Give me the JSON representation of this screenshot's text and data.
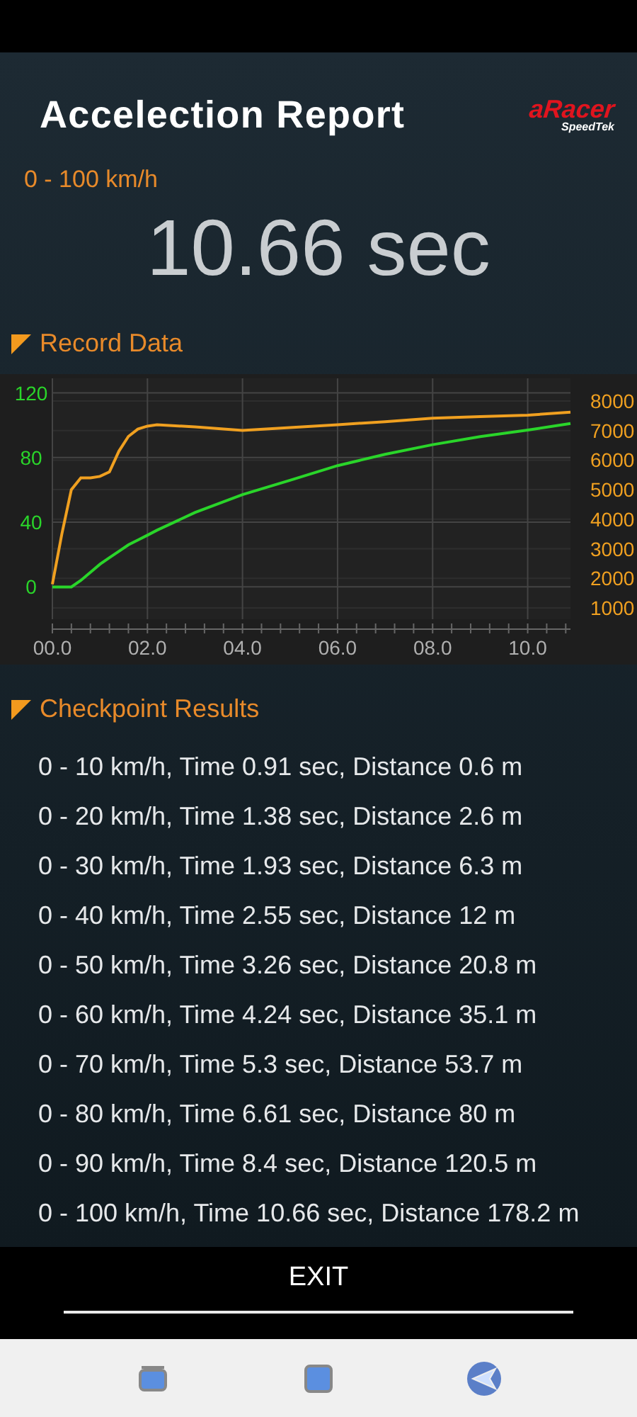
{
  "header": {
    "title": "Accelection Report",
    "logo": {
      "brand": "aRacer",
      "sub": "SpeedTek"
    }
  },
  "range": "0 - 100 km/h",
  "result": "10.66 sec",
  "record_section": {
    "title": "Record Data",
    "chart_data": {
      "type": "line",
      "grid": true,
      "xlim": [
        0,
        10.9
      ],
      "ylim": [
        -20,
        129
      ],
      "y2lim": [
        616,
        8766
      ],
      "xticks": [
        {
          "value": 0,
          "label": "00.0"
        },
        {
          "value": 2,
          "label": "02.0"
        },
        {
          "value": 4,
          "label": "04.0"
        },
        {
          "value": 6,
          "label": "06.0"
        },
        {
          "value": 8,
          "label": "08.0"
        },
        {
          "value": 10,
          "label": "10.0"
        }
      ],
      "yticks": [
        0,
        40,
        80,
        120
      ],
      "y2ticks": [
        1000,
        2000,
        3000,
        4000,
        5000,
        6000,
        7000,
        8000
      ],
      "x": [
        0,
        0.2,
        0.4,
        0.6,
        0.8,
        1.0,
        1.2,
        1.4,
        1.6,
        1.8,
        2.0,
        2.2,
        3.0,
        4.0,
        5.0,
        6.0,
        7.0,
        8.0,
        9.0,
        10.0,
        10.9
      ],
      "series": [
        {
          "color": "#2ad52a",
          "values": [
            0,
            0,
            0,
            4,
            9,
            14,
            18,
            22,
            26,
            29,
            32,
            35,
            46,
            57,
            66,
            75,
            82,
            88,
            93,
            97,
            101
          ]
        },
        {
          "color": "#f0a020",
          "axis": "y2",
          "values": [
            1800,
            3500,
            5000,
            5400,
            5400,
            5450,
            5600,
            6300,
            6800,
            7050,
            7150,
            7200,
            7120,
            7000,
            7100,
            7200,
            7300,
            7420,
            7470,
            7520,
            7620
          ]
        }
      ]
    }
  },
  "checkpoint_section": {
    "title": "Checkpoint Results",
    "items": [
      "0 - 10 km/h, Time 0.91 sec, Distance 0.6 m",
      "0 - 20 km/h, Time 1.38 sec, Distance 2.6 m",
      "0 - 30 km/h, Time 1.93 sec, Distance 6.3 m",
      "0 - 40 km/h, Time 2.55 sec, Distance 12 m",
      "0 - 50 km/h, Time 3.26 sec, Distance 20.8 m",
      "0 - 60 km/h, Time 4.24 sec, Distance 35.1 m",
      "0 - 70 km/h, Time 5.3 sec, Distance 53.7 m",
      "0 - 80 km/h, Time 6.61 sec, Distance 80 m",
      "0 - 90 km/h, Time 8.4 sec, Distance 120.5 m",
      "0 - 100 km/h, Time 10.66 sec, Distance 178.2 m"
    ]
  },
  "exit_button": "EXIT",
  "nav_bar": [
    {
      "kind": "recent"
    },
    {
      "kind": "home"
    },
    {
      "kind": "back"
    }
  ]
}
